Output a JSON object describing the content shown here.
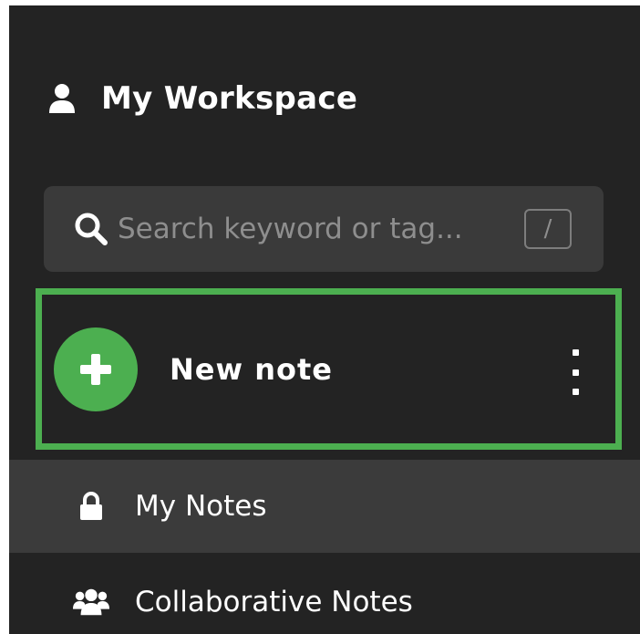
{
  "workspace": {
    "title": "My Workspace",
    "icon": "user-icon"
  },
  "search": {
    "placeholder": "Search keyword or tag...",
    "shortcut": "/",
    "icon": "search-icon"
  },
  "new_note": {
    "label": "New note",
    "icon": "plus-icon",
    "more_icon": "more-vertical-icon",
    "highlight_color": "#4caf50"
  },
  "nav": {
    "items": [
      {
        "label": "My Notes",
        "icon": "lock-icon",
        "active": true
      },
      {
        "label": "Collaborative Notes",
        "icon": "users-icon",
        "active": false
      }
    ]
  },
  "colors": {
    "background": "#232323",
    "accent": "#4caf50",
    "search_bg": "#3a3a3a",
    "active_item_bg": "#3b3b3b"
  }
}
